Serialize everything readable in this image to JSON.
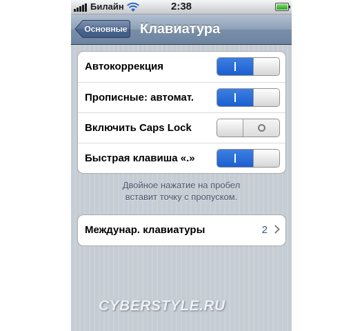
{
  "status_bar": {
    "carrier": "Билайн",
    "time": "2:38",
    "icons": [
      "signal-icon",
      "wifi-icon",
      "battery-icon"
    ]
  },
  "nav_bar": {
    "back_label": "Основные",
    "title": "Клавиатура"
  },
  "settings": {
    "autocorrection": {
      "label": "Автокоррекция",
      "state": "on"
    },
    "auto_caps": {
      "label": "Прописные: автомат.",
      "state": "on"
    },
    "caps_lock": {
      "label": "Включить Caps Lock",
      "state": "off"
    },
    "period_shortcut": {
      "label": "Быстрая клавиша «.»",
      "state": "on"
    }
  },
  "footnote": {
    "line1": "Двойное нажатие на пробел",
    "line2": "вставит точку с пропуском."
  },
  "international": {
    "label": "Междунар. клавиатуры",
    "value": "2",
    "icon": "chevron-right-icon"
  },
  "watermark": "CYBERSTYLE.RU",
  "colors": {
    "toggle_on": "#1a5fd2",
    "navbar": "#6d84a1",
    "detail_value": "#385487",
    "background": "#c5ccd4"
  }
}
